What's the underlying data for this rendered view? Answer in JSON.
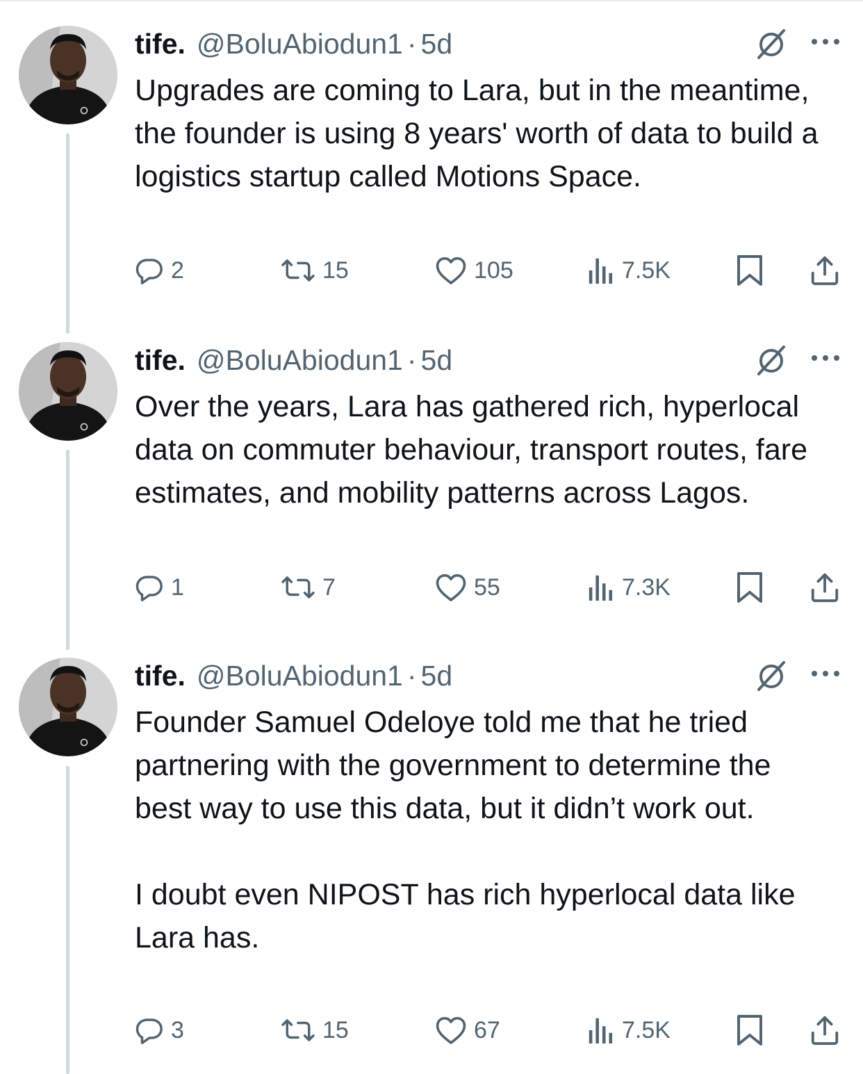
{
  "tweets": [
    {
      "name": "tife.",
      "handle": "@BoluAbiodun1",
      "separator": "·",
      "time": "5d",
      "text": "Upgrades are coming to Lara, but in the meantime, the founder is using 8 years' worth of data to build a logistics startup called Motions Space.",
      "replies": "2",
      "reposts": "15",
      "likes": "105",
      "views": "7.5K"
    },
    {
      "name": "tife.",
      "handle": "@BoluAbiodun1",
      "separator": "·",
      "time": "5d",
      "text": "Over the years, Lara has gathered rich, hyperlocal data on commuter behaviour, transport routes, fare estimates, and mobility patterns across Lagos.",
      "replies": "1",
      "reposts": "7",
      "likes": "55",
      "views": "7.3K"
    },
    {
      "name": "tife.",
      "handle": "@BoluAbiodun1",
      "separator": "·",
      "time": "5d",
      "text": "Founder Samuel Odeloye told me that he tried partnering with the government to determine the best way to use this data, but it didn’t work out.\n\nI doubt even NIPOST has rich hyperlocal data like Lara has.",
      "replies": "3",
      "reposts": "15",
      "likes": "67",
      "views": "7.5K"
    }
  ],
  "icons": {
    "reply": "speech-bubble",
    "repost": "two-arrows-loop",
    "like": "heart",
    "views": "bar-chart",
    "bookmark": "bookmark",
    "share": "upload-arrow",
    "grok": "slashed-circle",
    "more": "three-dots"
  },
  "colors": {
    "text_primary": "#0f1419",
    "text_secondary": "#536471",
    "thread_line": "#cfd9de"
  }
}
